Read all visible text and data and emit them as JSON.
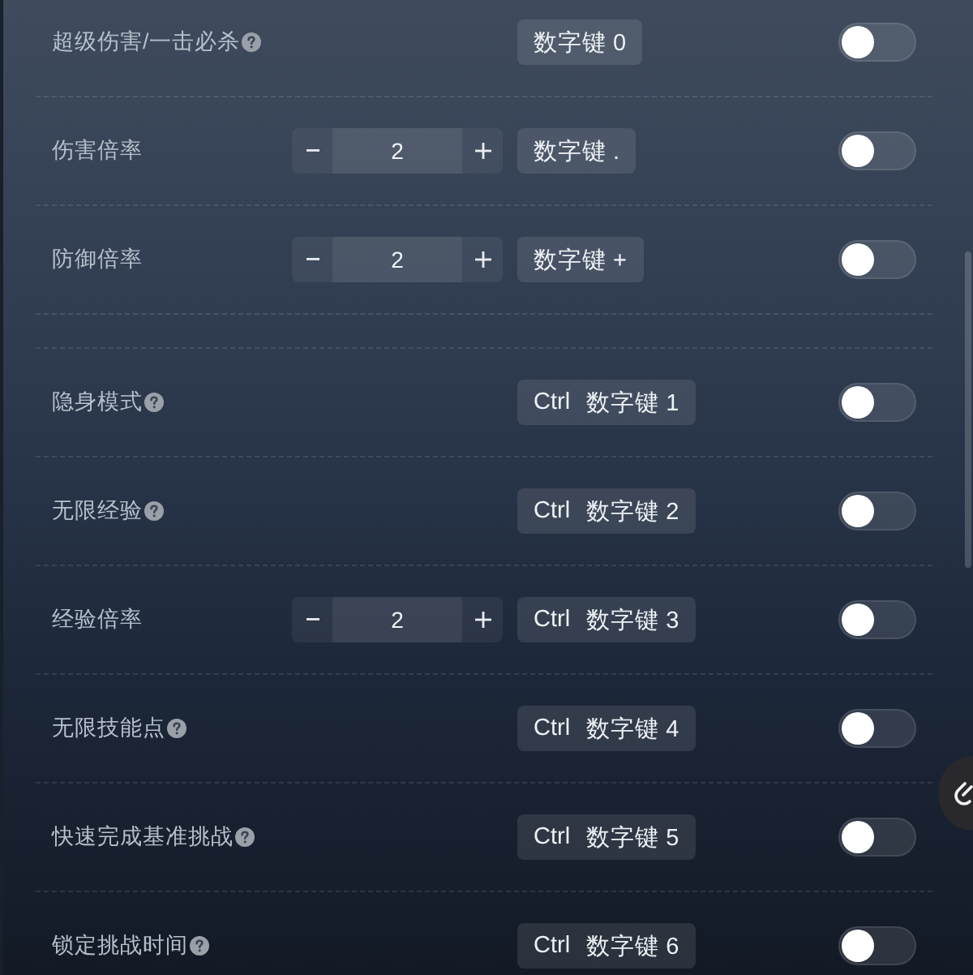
{
  "sections": [
    {
      "rows": [
        {
          "label": "超级伤害/一击必杀",
          "help": true,
          "hotkey": [
            "数字键 0"
          ],
          "on": false
        },
        {
          "label": "伤害倍率",
          "help": false,
          "stepper": {
            "value": "2"
          },
          "hotkey": [
            "数字键 ."
          ],
          "on": false
        },
        {
          "label": "防御倍率",
          "help": false,
          "stepper": {
            "value": "2"
          },
          "hotkey": [
            "数字键 +"
          ],
          "on": false
        }
      ]
    },
    {
      "rows": [
        {
          "label": "隐身模式",
          "help": true,
          "hotkey": [
            "Ctrl",
            "数字键 1"
          ],
          "on": false
        },
        {
          "label": "无限经验",
          "help": true,
          "hotkey": [
            "Ctrl",
            "数字键 2"
          ],
          "on": false
        },
        {
          "label": "经验倍率",
          "help": false,
          "stepper": {
            "value": "2"
          },
          "hotkey": [
            "Ctrl",
            "数字键 3"
          ],
          "on": false
        },
        {
          "label": "无限技能点",
          "help": true,
          "hotkey": [
            "Ctrl",
            "数字键 4"
          ],
          "on": false
        },
        {
          "label": "快速完成基准挑战",
          "help": true,
          "hotkey": [
            "Ctrl",
            "数字键 5"
          ],
          "on": false
        },
        {
          "label": "锁定挑战时间",
          "help": true,
          "hotkey": [
            "Ctrl",
            "数字键 6"
          ],
          "on": false
        }
      ]
    }
  ]
}
